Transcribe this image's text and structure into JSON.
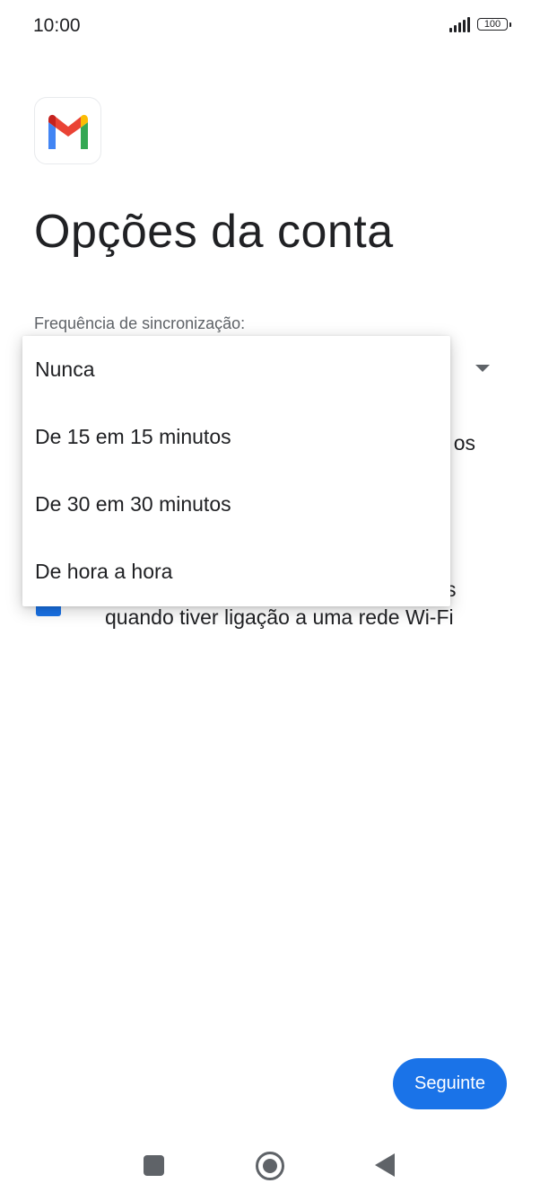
{
  "status_bar": {
    "time": "10:00",
    "battery": "100",
    "signal_icon": "signal-bars-icon",
    "battery_icon": "battery-icon"
  },
  "app": {
    "logo_icon": "gmail-logo-icon",
    "title": "Opções da conta"
  },
  "sync": {
    "label": "Frequência de sincronização:",
    "options": [
      "Nunca",
      "De 15 em 15 minutos",
      "De 30 em 30 minutos",
      "De hora a hora"
    ]
  },
  "background": {
    "fragment_1": "os",
    "fragment_2": "s",
    "wifi_text": "quando tiver ligação a uma rede Wi-Fi"
  },
  "footer": {
    "next_label": "Seguinte"
  },
  "colors": {
    "accent": "#1a73e8",
    "text": "#202124",
    "secondary_text": "#5f6368"
  }
}
